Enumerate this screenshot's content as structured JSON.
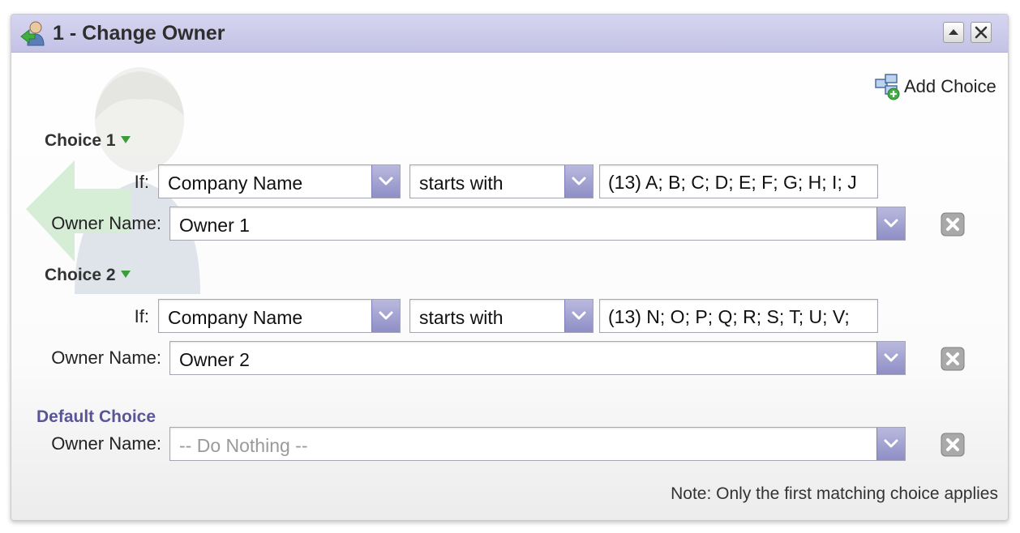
{
  "window": {
    "title": "1 - Change Owner",
    "icons": {
      "title": "user-arrow-icon",
      "collapse": "collapse-up-icon",
      "close": "close-icon"
    }
  },
  "toolbar": {
    "add_choice_label": "Add Choice",
    "add_choice_icon": "add-choice-icon"
  },
  "choices": [
    {
      "label": "Choice 1",
      "if_label": "If:",
      "field": "Company Name",
      "operator": "starts with",
      "value": "(13) A; B; C; D; E; F; G; H; I; J",
      "owner_label": "Owner Name:",
      "owner": "Owner 1"
    },
    {
      "label": "Choice 2",
      "if_label": "If:",
      "field": "Company Name",
      "operator": "starts with",
      "value": "(13) N; O; P; Q; R; S; T; U; V;",
      "owner_label": "Owner Name:",
      "owner": "Owner 2"
    }
  ],
  "default_choice": {
    "label": "Default Choice",
    "owner_label": "Owner Name:",
    "owner": "-- Do Nothing --"
  },
  "note": "Note: Only the first matching choice applies",
  "colors": {
    "titlebar": "#c7c6e8",
    "dropdown_button": "#9f9ed0",
    "default_label": "#5a5596",
    "caret": "#3a9d3a"
  }
}
